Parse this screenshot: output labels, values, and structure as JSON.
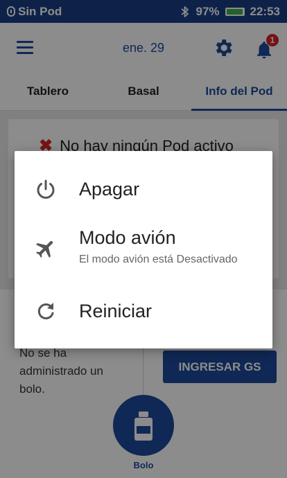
{
  "status_bar": {
    "left_label": "Sin Pod",
    "battery": "97%",
    "battery_level": 0.97,
    "time": "22:53",
    "icons": [
      "pod-status-icon",
      "bluetooth-icon",
      "battery-icon"
    ]
  },
  "header": {
    "date": "ene. 29",
    "notification_count": "1",
    "icons": [
      "menu-icon",
      "gear-icon",
      "bell-icon"
    ]
  },
  "tabs": [
    {
      "label": "Tablero"
    },
    {
      "label": "Basal"
    },
    {
      "label": "Info del Pod"
    }
  ],
  "pod_info": {
    "message": "No hay ningún Pod activo"
  },
  "bolus": {
    "status_text": "No se ha administrado un bolo.",
    "enter_bg_label": "INGRESAR GS",
    "fab_label": "Bolo"
  },
  "dialog": {
    "options": [
      {
        "title": "Apagar",
        "subtitle": "",
        "icon": "power-icon"
      },
      {
        "title": "Modo avión",
        "subtitle": "El modo avión está Desactivado",
        "icon": "airplane-icon"
      },
      {
        "title": "Reiniciar",
        "subtitle": "",
        "icon": "restart-icon"
      }
    ]
  },
  "colors": {
    "primary": "#1c4a9c",
    "status_bar": "#1a3f86",
    "error": "#d6262b",
    "battery": "#3cb54a"
  }
}
